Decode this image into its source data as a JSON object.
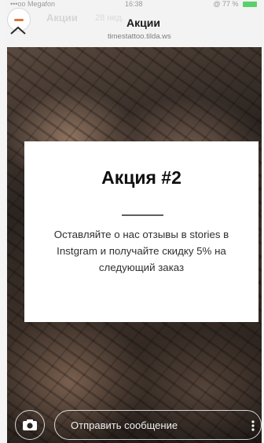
{
  "status_bar": {
    "carrier": "•••oo Megafon",
    "time": "16:38",
    "battery_text": "@ 77 %"
  },
  "story": {
    "username": "Акции",
    "time_ago": "28 нед."
  },
  "header": {
    "title": "Акции",
    "url": "timestattoo.tilda.ws"
  },
  "card": {
    "title": "Акция #2",
    "text": "Оставляйте о нас отзывы в stories в Instgram и получайте скидку 5% на следующий заказ"
  },
  "composer": {
    "placeholder": "Отправить сообщение"
  },
  "icons": [
    "collapse-chevron-icon",
    "camera-icon",
    "more-options-icon"
  ],
  "colors": {
    "header_bg": "#f3f3f3",
    "card_bg": "#ffffff",
    "avatar_accent": "#e1743a",
    "battery": "#5bd06a"
  }
}
